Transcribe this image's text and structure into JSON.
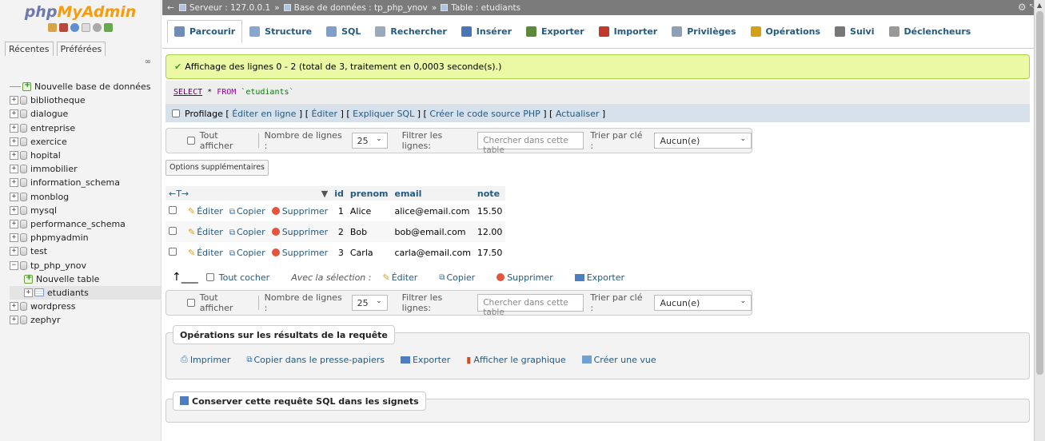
{
  "logo": {
    "php": "php",
    "myadmin": "MyAdmin"
  },
  "left_tabs": [
    "Récentes",
    "Préférées"
  ],
  "left_link": "∞",
  "tree": {
    "new_db": "Nouvelle base de données",
    "dbs": [
      "bibliotheque",
      "dialogue",
      "entreprise",
      "exercice",
      "hopital",
      "immobilier",
      "information_schema",
      "monblog",
      "mysql",
      "performance_schema",
      "phpmyadmin",
      "test"
    ],
    "current_db": "tp_php_ynov",
    "new_table": "Nouvelle table",
    "current_table": "etudiants",
    "dbs_after": [
      "wordpress",
      "zephyr"
    ]
  },
  "breadcrumb": {
    "server": "Serveur : 127.0.0.1",
    "database": "Base de données : tp_php_ynov",
    "table": "Table : etudiants",
    "sep": "»"
  },
  "menu_tabs": [
    {
      "label": "Parcourir",
      "icon": "browse-icon",
      "color": "#6d8db5"
    },
    {
      "label": "Structure",
      "icon": "structure-icon",
      "color": "#8aa6cc"
    },
    {
      "label": "SQL",
      "icon": "sql-icon",
      "color": "#7f9fc6"
    },
    {
      "label": "Rechercher",
      "icon": "search-icon",
      "color": "#9aa9bb"
    },
    {
      "label": "Insérer",
      "icon": "insert-icon",
      "color": "#4a76b5"
    },
    {
      "label": "Exporter",
      "icon": "export-icon",
      "color": "#5c8a3a"
    },
    {
      "label": "Importer",
      "icon": "import-icon",
      "color": "#c0392b"
    },
    {
      "label": "Privilèges",
      "icon": "privileges-icon",
      "color": "#8da0b6"
    },
    {
      "label": "Opérations",
      "icon": "operations-icon",
      "color": "#d4a017"
    },
    {
      "label": "Suivi",
      "icon": "tracking-icon",
      "color": "#777777"
    },
    {
      "label": "Déclencheurs",
      "icon": "triggers-icon",
      "color": "#999999"
    }
  ],
  "success_msg": "Affichage des lignes 0 - 2 (total de 3, traitement en 0,0003 seconde(s).)",
  "sql": {
    "select": "SELECT",
    "star": " * ",
    "from": "FROM",
    "table": " `etudiants`"
  },
  "profil": {
    "label": "Profilage",
    "links": [
      "Éditer en ligne",
      "Éditer",
      "Expliquer SQL",
      "Créer le code source PHP",
      "Actualiser"
    ]
  },
  "nav": {
    "show_all": "Tout afficher",
    "rows_label": "Nombre de lignes :",
    "rows_value": "25",
    "filter_label": "Filtrer les lignes:",
    "filter_placeholder": "Chercher dans cette table",
    "sort_label": "Trier par clé :",
    "sort_value": "Aucun(e)"
  },
  "options_btn": "Options supplémentaires",
  "table": {
    "columns": [
      "id",
      "prenom",
      "email",
      "note"
    ],
    "col_arrows": "←T→",
    "sort_marker": "▼",
    "actions": {
      "edit": "Éditer",
      "copy": "Copier",
      "delete": "Supprimer"
    },
    "rows": [
      {
        "id": "1",
        "prenom": "Alice",
        "email": "alice@email.com",
        "note": "15.50"
      },
      {
        "id": "2",
        "prenom": "Bob",
        "email": "bob@email.com",
        "note": "12.00"
      },
      {
        "id": "3",
        "prenom": "Carla",
        "email": "carla@email.com",
        "note": "17.50"
      }
    ]
  },
  "bulk": {
    "check_all": "Tout cocher",
    "with_selection": "Avec la sélection :",
    "edit": "Éditer",
    "copy": "Copier",
    "delete": "Supprimer",
    "export": "Exporter"
  },
  "ops": {
    "legend": "Opérations sur les résultats de la requête",
    "print": "Imprimer",
    "copy_clipboard": "Copier dans le presse-papiers",
    "export": "Exporter",
    "chart": "Afficher le graphique",
    "view": "Créer une vue"
  },
  "bookmark": {
    "legend": "Conserver cette requête SQL dans les signets"
  },
  "colors": {
    "link": "#235a81",
    "success_bg": "#ebf8a4",
    "profil_bg": "#d6e1ec"
  }
}
